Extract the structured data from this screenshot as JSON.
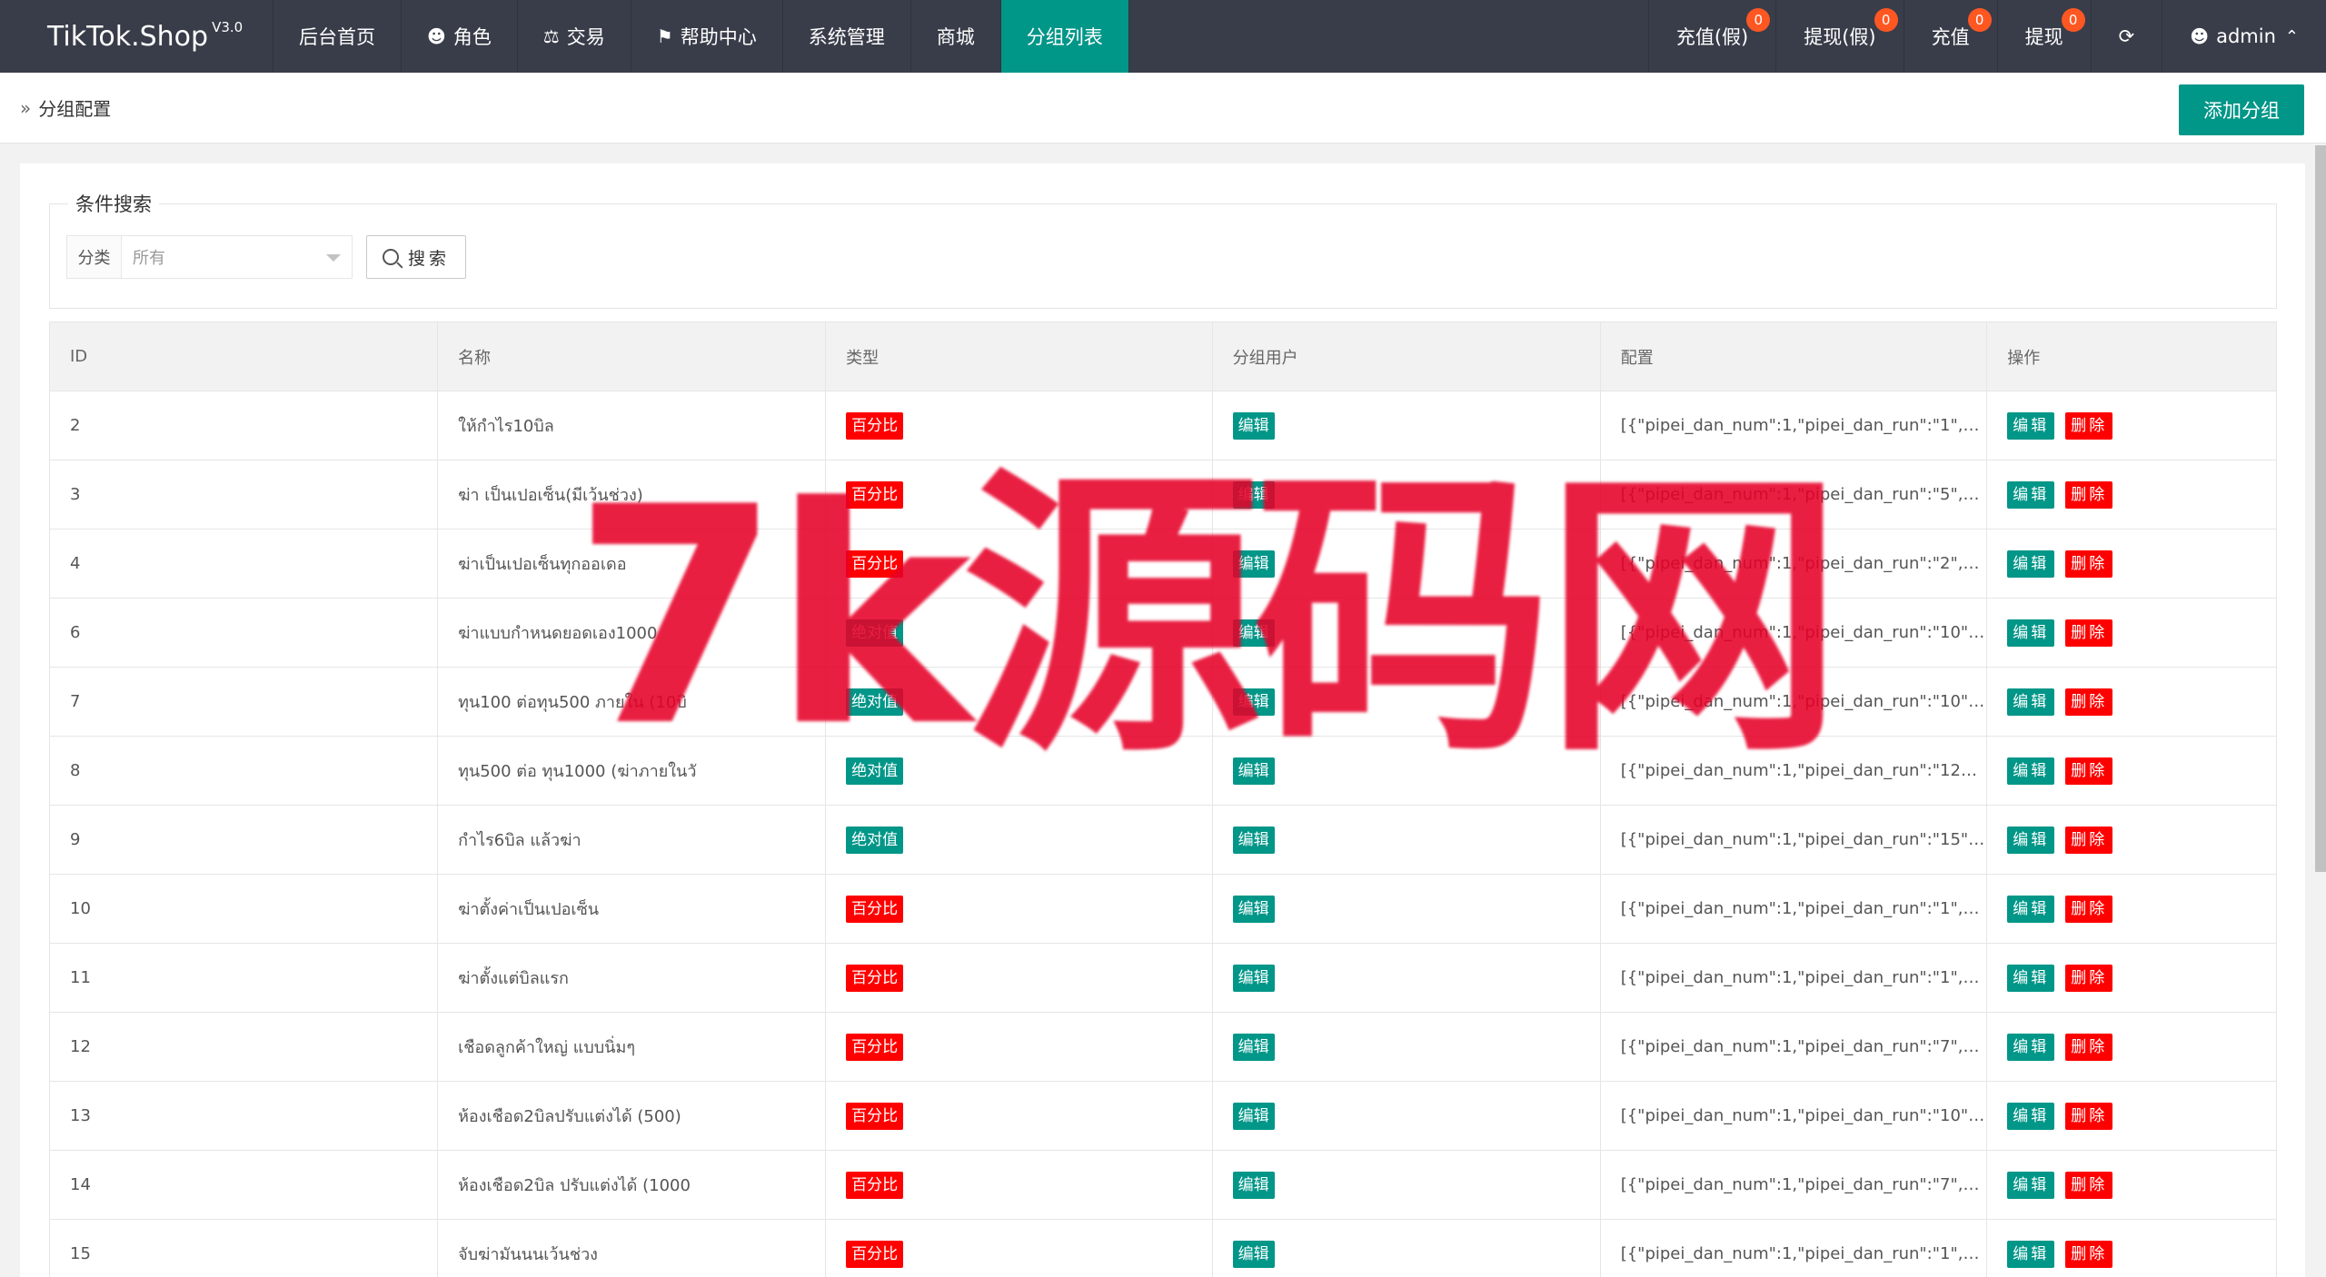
{
  "app": {
    "logo": "TikTok.Shop",
    "version": "V3.0"
  },
  "nav": {
    "items": [
      {
        "label": "后台首页",
        "icon": ""
      },
      {
        "label": "角色",
        "icon": "user-icon"
      },
      {
        "label": "交易",
        "icon": "scale-icon"
      },
      {
        "label": "帮助中心",
        "icon": "flag-icon"
      },
      {
        "label": "系统管理",
        "icon": ""
      },
      {
        "label": "商城",
        "icon": ""
      },
      {
        "label": "分组列表",
        "icon": "",
        "active": true
      }
    ],
    "right": [
      {
        "label": "充值(假)",
        "badge": "0"
      },
      {
        "label": "提现(假)",
        "badge": "0"
      },
      {
        "label": "充值",
        "badge": "0"
      },
      {
        "label": "提现",
        "badge": "0"
      }
    ],
    "refresh_icon": "refresh-icon",
    "user": "admin"
  },
  "breadcrumb": {
    "current": "分组配置",
    "add_button": "添加分组"
  },
  "search": {
    "legend": "条件搜索",
    "category_label": "分类",
    "category_value": "所有",
    "search_button": "搜索"
  },
  "table": {
    "columns": [
      "ID",
      "名称",
      "类型",
      "分组用户",
      "配置",
      "操作"
    ],
    "edit_label": "编辑",
    "delete_label": "删除",
    "rows": [
      {
        "id": "2",
        "name": "ให้กำไร10บิล",
        "type": "百分比",
        "type_color": "red",
        "config": "[{\"pipei_dan_num\":1,\"pipei_dan_run\":\"1\",\"pip..."
      },
      {
        "id": "3",
        "name": "ฆ่า เป็นเปอเซ็น(มีเว้นช่วง)",
        "type": "百分比",
        "type_color": "red",
        "config": "[{\"pipei_dan_num\":1,\"pipei_dan_run\":\"5\",\"pip..."
      },
      {
        "id": "4",
        "name": "ฆ่าเป็นเปอเซ็นทุกออเดอ",
        "type": "百分比",
        "type_color": "red",
        "config": "[{\"pipei_dan_num\":1,\"pipei_dan_run\":\"2\",\"pip..."
      },
      {
        "id": "6",
        "name": "ฆ่าแบบกำหนดยอดเอง1000",
        "type": "绝对值",
        "type_color": "green",
        "config": "[{\"pipei_dan_num\":1,\"pipei_dan_run\":\"10\",\"pi..."
      },
      {
        "id": "7",
        "name": "ทุน100 ต่อทุน500 ภายใน (10บิ",
        "type": "绝对值",
        "type_color": "green",
        "config": "[{\"pipei_dan_num\":1,\"pipei_dan_run\":\"10\",\"pi..."
      },
      {
        "id": "8",
        "name": "ทุน500 ต่อ ทุน1000 (ฆ่าภายในวั",
        "type": "绝对值",
        "type_color": "green",
        "config": "[{\"pipei_dan_num\":1,\"pipei_dan_run\":\"120\",\"p..."
      },
      {
        "id": "9",
        "name": "กำไร6บิล แล้วฆ่า",
        "type": "绝对值",
        "type_color": "green",
        "config": "[{\"pipei_dan_num\":1,\"pipei_dan_run\":\"15\",\"pi..."
      },
      {
        "id": "10",
        "name": "ฆ่าตั้งค่าเป็นเปอเซ็น",
        "type": "百分比",
        "type_color": "red",
        "config": "[{\"pipei_dan_num\":1,\"pipei_dan_run\":\"1\",\"pip..."
      },
      {
        "id": "11",
        "name": "ฆ่าตั้งแต่บิลแรก",
        "type": "百分比",
        "type_color": "red",
        "config": "[{\"pipei_dan_num\":1,\"pipei_dan_run\":\"1\",\"pip..."
      },
      {
        "id": "12",
        "name": "เชือดลูกค้าใหญ่ แบบนิ่มๆ",
        "type": "百分比",
        "type_color": "red",
        "config": "[{\"pipei_dan_num\":1,\"pipei_dan_run\":\"7\",\"pip..."
      },
      {
        "id": "13",
        "name": "ห้องเชือด2บิลปรับแต่งได้ (500)",
        "type": "百分比",
        "type_color": "red",
        "config": "[{\"pipei_dan_num\":1,\"pipei_dan_run\":\"10\",\"pi..."
      },
      {
        "id": "14",
        "name": "ห้องเชือด2บิล ปรับแต่งได้ (1000",
        "type": "百分比",
        "type_color": "red",
        "config": "[{\"pipei_dan_num\":1,\"pipei_dan_run\":\"7\",\"pip..."
      },
      {
        "id": "15",
        "name": "จับฆ่ามันนนเว้นช่วง",
        "type": "百分比",
        "type_color": "red",
        "config": "[{\"pipei_dan_num\":1,\"pipei_dan_run\":\"1\",\"pip..."
      }
    ]
  },
  "watermark": "7k源码网"
}
